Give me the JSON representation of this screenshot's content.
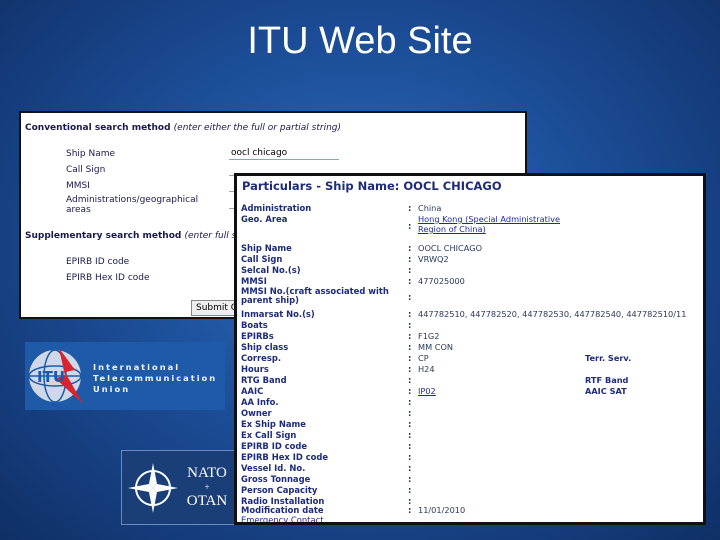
{
  "slide": {
    "title": "ITU Web Site"
  },
  "search": {
    "conventional_heading": "Conventional search method",
    "conventional_hint": "(enter either the full or partial string)",
    "fields": [
      {
        "label": "Ship Name",
        "value": "oocl chicago"
      },
      {
        "label": "Call Sign",
        "value": ""
      },
      {
        "label": "MMSI",
        "value": ""
      },
      {
        "label": "Administrations/geographical areas",
        "value": ""
      }
    ],
    "supplementary_heading": "Supplementary search method",
    "supplementary_hint": "(enter full st",
    "supp_fields": [
      {
        "label": "EPIRB ID code"
      },
      {
        "label": "EPIRB Hex ID code"
      }
    ],
    "submit_label": "Submit Q"
  },
  "particulars": {
    "title": "Particulars - Ship Name: OOCL CHICAGO",
    "rows": [
      {
        "label": "Administration",
        "value": "China",
        "extra_label": ""
      },
      {
        "label": "Geo. Area",
        "value": "Hong Kong (Special Administrative Region of China)",
        "extra_label": ""
      },
      {
        "label": "Ship Name",
        "value": "OOCL CHICAGO",
        "extra_label": ""
      },
      {
        "label": "Call Sign",
        "value": "VRWQ2",
        "extra_label": ""
      },
      {
        "label": "Selcal No.(s)",
        "value": "",
        "extra_label": ""
      },
      {
        "label": "MMSI",
        "value": "477025000",
        "extra_label": ""
      },
      {
        "label": "MMSI No.(craft associated with parent ship)",
        "value": "",
        "extra_label": ""
      },
      {
        "label": "Inmarsat No.(s)",
        "value": "447782510, 447782520, 447782530, 447782540, 447782510/11",
        "extra_label": ""
      },
      {
        "label": "Boats",
        "value": "",
        "extra_label": ""
      },
      {
        "label": "EPIRBs",
        "value": "F1G2",
        "extra_label": ""
      },
      {
        "label": "Ship class",
        "value": "MM CON",
        "extra_label": ""
      },
      {
        "label": "Corresp.",
        "value": "CP",
        "extra_label": "Terr. Serv."
      },
      {
        "label": "Hours",
        "value": "H24",
        "extra_label": ""
      },
      {
        "label": "RTG Band",
        "value": "",
        "extra_label": "RTF Band"
      },
      {
        "label": "AAIC",
        "value": "IP02",
        "extra_label": "AAIC SAT"
      },
      {
        "label": "AA Info.",
        "value": "",
        "extra_label": ""
      },
      {
        "label": "Owner",
        "value": "",
        "extra_label": ""
      },
      {
        "label": "Ex Ship Name",
        "value": "",
        "extra_label": ""
      },
      {
        "label": "Ex Call Sign",
        "value": "",
        "extra_label": ""
      },
      {
        "label": "EPIRB ID code",
        "value": "",
        "extra_label": ""
      },
      {
        "label": "EPIRB Hex ID code",
        "value": "",
        "extra_label": ""
      },
      {
        "label": "Vessel Id. No.",
        "value": "",
        "extra_label": ""
      },
      {
        "label": "Gross Tonnage",
        "value": "",
        "extra_label": ""
      },
      {
        "label": "Person Capacity",
        "value": "",
        "extra_label": ""
      },
      {
        "label": "Radio Installation",
        "value": "",
        "extra_label": ""
      },
      {
        "label": "Modification date",
        "value": "11/01/2010",
        "extra_label": ""
      }
    ],
    "emergency_link": "Emergency Contact"
  },
  "logos": {
    "itu_line1": "International",
    "itu_line2": "Telecommunication",
    "itu_line3": "Union",
    "itu_mark": "ITU",
    "nato_top": "NATO",
    "nato_bottom": "OTAN"
  },
  "colors": {
    "background": "#1d4f9a",
    "heading_navy": "#1d2b7a",
    "link": "#1d2b9a",
    "itu_blue": "#1e5aa8",
    "itu_red": "#d9232e"
  }
}
